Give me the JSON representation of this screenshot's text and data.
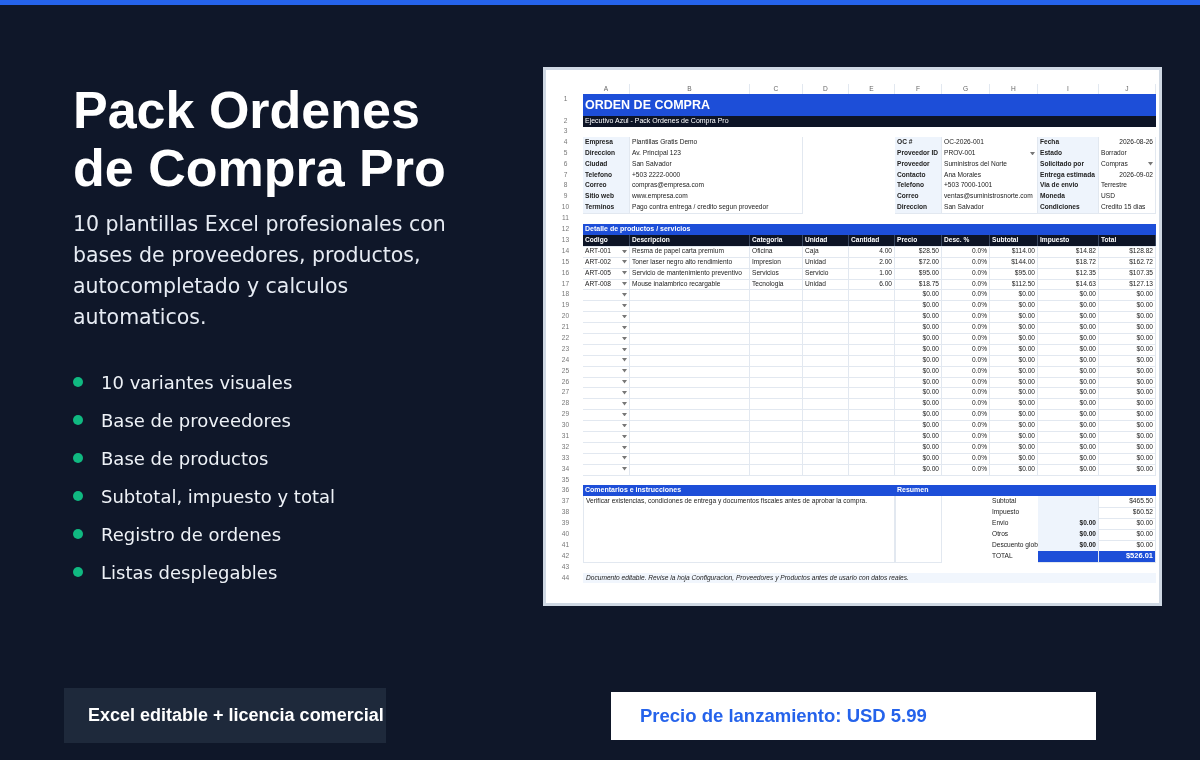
{
  "title_lines": [
    "Pack Ordenes",
    "de Compra Pro"
  ],
  "subtitle": "10 plantillas Excel profesionales con bases de proveedores, productos, autocompletado y calculos automaticos.",
  "features": [
    "10 variantes visuales",
    "Base de proveedores",
    "Base de productos",
    "Subtotal, impuesto y total",
    "Registro de ordenes",
    "Listas desplegables"
  ],
  "license_badge": "Excel editable + licencia comercial",
  "price_badge": "Precio de lanzamiento: USD 5.99",
  "sheet": {
    "columns": [
      "A",
      "B",
      "C",
      "D",
      "E",
      "F",
      "G",
      "H",
      "I",
      "J"
    ],
    "rows": [
      {
        "n": "1",
        "kind": "title",
        "text": "ORDEN DE COMPRA"
      },
      {
        "n": "2",
        "kind": "subtitle",
        "text": "Ejecutivo Azul - Pack Ordenes de Compra Pro"
      },
      {
        "n": "3",
        "kind": "blank"
      },
      {
        "n": "4",
        "kind": "info",
        "fields": [
          {
            "label": "Empresa",
            "value": "Plantillas Gratis Demo",
            "kind": "text"
          },
          {
            "label": "OC #",
            "value": "OC-2026-001",
            "kind": "text"
          },
          {
            "label": "Fecha",
            "value": "2026-08-26",
            "kind": "date"
          }
        ]
      },
      {
        "n": "5",
        "kind": "info",
        "fields": [
          {
            "label": "Direccion",
            "value": "Av. Principal 123",
            "kind": "text"
          },
          {
            "label": "Proveedor ID",
            "value": "PROV-001",
            "kind": "text",
            "dropdown": true
          },
          {
            "label": "Estado",
            "value": "Borrador",
            "kind": "text"
          }
        ]
      },
      {
        "n": "6",
        "kind": "info",
        "fields": [
          {
            "label": "Ciudad",
            "value": "San Salvador",
            "kind": "text"
          },
          {
            "label": "Proveedor",
            "value": "Suministros del Norte",
            "kind": "text"
          },
          {
            "label": "Solicitado por",
            "value": "Compras",
            "kind": "text",
            "dropdown": true
          }
        ]
      },
      {
        "n": "7",
        "kind": "info",
        "fields": [
          {
            "label": "Telefono",
            "value": "+503 2222-0000",
            "kind": "text"
          },
          {
            "label": "Contacto",
            "value": "Ana Morales",
            "kind": "text"
          },
          {
            "label": "Entrega estimada",
            "value": "2026-09-02",
            "kind": "date"
          }
        ]
      },
      {
        "n": "8",
        "kind": "info",
        "fields": [
          {
            "label": "Correo",
            "value": "compras@empresa.com",
            "kind": "text"
          },
          {
            "label": "Telefono",
            "value": "+503 7000-1001",
            "kind": "text"
          },
          {
            "label": "Via de envio",
            "value": "Terrestre",
            "kind": "text"
          }
        ]
      },
      {
        "n": "9",
        "kind": "info",
        "fields": [
          {
            "label": "Sitio web",
            "value": "www.empresa.com",
            "kind": "text"
          },
          {
            "label": "Correo",
            "value": "ventas@suministrosnorte.com",
            "kind": "text"
          },
          {
            "label": "Moneda",
            "value": "USD",
            "kind": "text"
          }
        ]
      },
      {
        "n": "10",
        "kind": "info",
        "fields": [
          {
            "label": "Terminos",
            "value": "Pago contra entrega / credito segun proveedor",
            "kind": "text"
          },
          {
            "label": "Direccion",
            "value": "San Salvador",
            "kind": "text"
          },
          {
            "label": "Condiciones",
            "value": "Credito 15 dias",
            "kind": "text"
          }
        ]
      },
      {
        "n": "11",
        "kind": "blank"
      },
      {
        "n": "12",
        "kind": "section",
        "text": "Detalle de productos / servicios"
      },
      {
        "n": "13",
        "kind": "header",
        "cells": [
          "Codigo",
          "Descripcion",
          "Categoria",
          "Unidad",
          "Cantidad",
          "Precio",
          "Desc. %",
          "Subtotal",
          "Impuesto",
          "Total"
        ]
      },
      {
        "n": "14",
        "kind": "item",
        "dropdown": true,
        "code": "ART-001",
        "description": "Resma de papel carta premium",
        "category": "Oficina",
        "unit": "Caja",
        "qty": "4.00",
        "price": "$28.50",
        "discount": "0.0%",
        "subtotal": "$114.00",
        "tax": "$14.82",
        "total": "$128.82"
      },
      {
        "n": "15",
        "kind": "item",
        "dropdown": true,
        "code": "ART-002",
        "description": "Toner laser negro alto rendimiento",
        "category": "Impresion",
        "unit": "Unidad",
        "qty": "2.00",
        "price": "$72.00",
        "discount": "0.0%",
        "subtotal": "$144.00",
        "tax": "$18.72",
        "total": "$162.72"
      },
      {
        "n": "16",
        "kind": "item",
        "dropdown": true,
        "code": "ART-005",
        "description": "Servicio de mantenimiento preventivo",
        "category": "Servicios",
        "unit": "Servicio",
        "qty": "1.00",
        "price": "$95.00",
        "discount": "0.0%",
        "subtotal": "$95.00",
        "tax": "$12.35",
        "total": "$107.35"
      },
      {
        "n": "17",
        "kind": "item",
        "dropdown": true,
        "code": "ART-008",
        "description": "Mouse inalambrico recargable",
        "category": "Tecnologia",
        "unit": "Unidad",
        "qty": "6.00",
        "price": "$18.75",
        "discount": "0.0%",
        "subtotal": "$112.50",
        "tax": "$14.63",
        "total": "$127.13"
      },
      {
        "n": "18",
        "kind": "item",
        "dropdown": true,
        "price": "$0.00",
        "discount": "0.0%",
        "subtotal": "$0.00",
        "tax": "$0.00",
        "total": "$0.00"
      },
      {
        "n": "19",
        "kind": "item",
        "dropdown": true,
        "price": "$0.00",
        "discount": "0.0%",
        "subtotal": "$0.00",
        "tax": "$0.00",
        "total": "$0.00"
      },
      {
        "n": "20",
        "kind": "item",
        "dropdown": true,
        "price": "$0.00",
        "discount": "0.0%",
        "subtotal": "$0.00",
        "tax": "$0.00",
        "total": "$0.00"
      },
      {
        "n": "21",
        "kind": "item",
        "dropdown": true,
        "price": "$0.00",
        "discount": "0.0%",
        "subtotal": "$0.00",
        "tax": "$0.00",
        "total": "$0.00"
      },
      {
        "n": "22",
        "kind": "item",
        "dropdown": true,
        "price": "$0.00",
        "discount": "0.0%",
        "subtotal": "$0.00",
        "tax": "$0.00",
        "total": "$0.00"
      },
      {
        "n": "23",
        "kind": "item",
        "dropdown": true,
        "price": "$0.00",
        "discount": "0.0%",
        "subtotal": "$0.00",
        "tax": "$0.00",
        "total": "$0.00"
      },
      {
        "n": "24",
        "kind": "item",
        "dropdown": true,
        "price": "$0.00",
        "discount": "0.0%",
        "subtotal": "$0.00",
        "tax": "$0.00",
        "total": "$0.00"
      },
      {
        "n": "25",
        "kind": "item",
        "dropdown": true,
        "price": "$0.00",
        "discount": "0.0%",
        "subtotal": "$0.00",
        "tax": "$0.00",
        "total": "$0.00"
      },
      {
        "n": "26",
        "kind": "item",
        "dropdown": true,
        "price": "$0.00",
        "discount": "0.0%",
        "subtotal": "$0.00",
        "tax": "$0.00",
        "total": "$0.00"
      },
      {
        "n": "27",
        "kind": "item",
        "dropdown": true,
        "price": "$0.00",
        "discount": "0.0%",
        "subtotal": "$0.00",
        "tax": "$0.00",
        "total": "$0.00"
      },
      {
        "n": "28",
        "kind": "item",
        "dropdown": true,
        "price": "$0.00",
        "discount": "0.0%",
        "subtotal": "$0.00",
        "tax": "$0.00",
        "total": "$0.00"
      },
      {
        "n": "29",
        "kind": "item",
        "dropdown": true,
        "price": "$0.00",
        "discount": "0.0%",
        "subtotal": "$0.00",
        "tax": "$0.00",
        "total": "$0.00"
      },
      {
        "n": "30",
        "kind": "item",
        "dropdown": true,
        "price": "$0.00",
        "discount": "0.0%",
        "subtotal": "$0.00",
        "tax": "$0.00",
        "total": "$0.00"
      },
      {
        "n": "31",
        "kind": "item",
        "dropdown": true,
        "price": "$0.00",
        "discount": "0.0%",
        "subtotal": "$0.00",
        "tax": "$0.00",
        "total": "$0.00"
      },
      {
        "n": "32",
        "kind": "item",
        "dropdown": true,
        "price": "$0.00",
        "discount": "0.0%",
        "subtotal": "$0.00",
        "tax": "$0.00",
        "total": "$0.00"
      },
      {
        "n": "33",
        "kind": "item",
        "dropdown": true,
        "price": "$0.00",
        "discount": "0.0%",
        "subtotal": "$0.00",
        "tax": "$0.00",
        "total": "$0.00"
      },
      {
        "n": "34",
        "kind": "item",
        "dropdown": true,
        "price": "$0.00",
        "discount": "0.0%",
        "subtotal": "$0.00",
        "tax": "$0.00",
        "total": "$0.00"
      },
      {
        "n": "35",
        "kind": "blank"
      },
      {
        "n": "36",
        "kind": "split_section",
        "text": "Comentarios e instrucciones",
        "text2": "Resumen"
      },
      {
        "n": "37",
        "kind": "summary",
        "comment": "Verificar existencias, condiciones de entrega y documentos fiscales antes de aprobar la compra.",
        "label": "Subtotal",
        "value": "$465.50"
      },
      {
        "n": "38",
        "kind": "summary",
        "label": "Impuesto",
        "value": "$60.52"
      },
      {
        "n": "39",
        "kind": "summary",
        "label": "Envio",
        "input": "$0.00",
        "value": "$0.00"
      },
      {
        "n": "40",
        "kind": "summary",
        "label": "Otros",
        "input": "$0.00",
        "value": "$0.00"
      },
      {
        "n": "41",
        "kind": "summary",
        "label": "Descuento glob",
        "input": "$0.00",
        "value": "$0.00"
      },
      {
        "n": "42",
        "kind": "total",
        "label": "TOTAL",
        "value": "$526.01"
      },
      {
        "n": "43",
        "kind": "blank"
      },
      {
        "n": "44",
        "kind": "note",
        "text": "Documento editable. Revise la hoja Configuracion, Proveedores y Productos antes de usarlo con datos reales."
      }
    ]
  }
}
